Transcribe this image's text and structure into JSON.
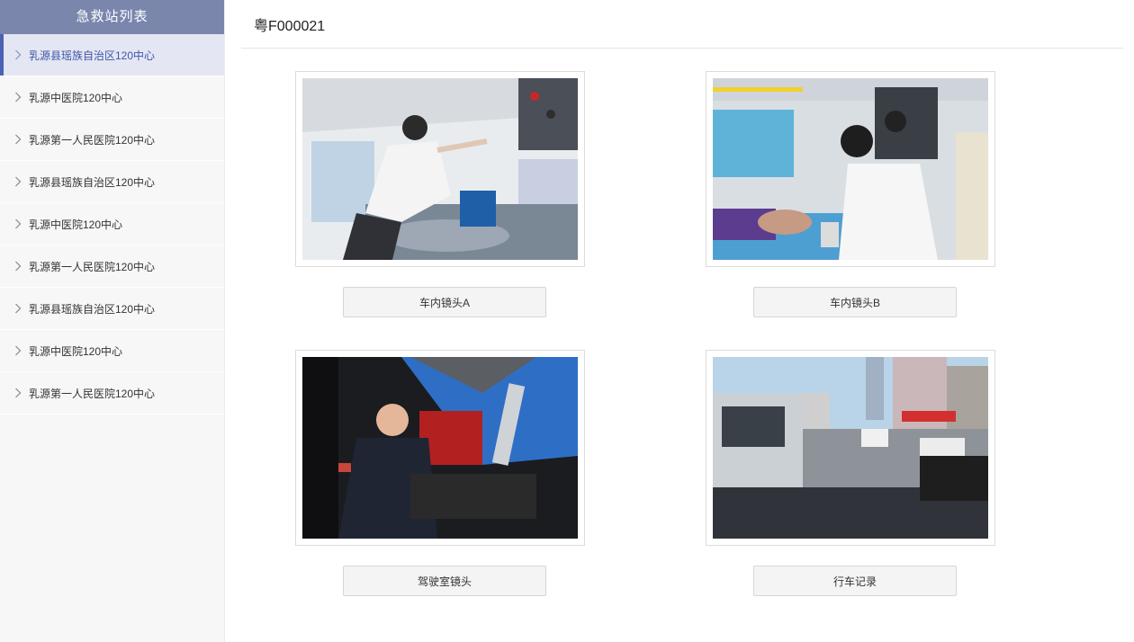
{
  "sidebar": {
    "title": "急救站列表",
    "items": [
      {
        "label": "乳源县瑶族自治区120中心",
        "active": true
      },
      {
        "label": "乳源中医院120中心",
        "active": false
      },
      {
        "label": "乳源第一人民医院120中心",
        "active": false
      },
      {
        "label": "乳源县瑶族自治区120中心",
        "active": false
      },
      {
        "label": "乳源中医院120中心",
        "active": false
      },
      {
        "label": "乳源第一人民医院120中心",
        "active": false
      },
      {
        "label": "乳源县瑶族自治区120中心",
        "active": false
      },
      {
        "label": "乳源中医院120中心",
        "active": false
      },
      {
        "label": "乳源第一人民医院120中心",
        "active": false
      }
    ]
  },
  "header": {
    "plate": "粤F000021"
  },
  "cameras": [
    {
      "label": "车内镜头A",
      "photo": "ambulance-interior-nurse"
    },
    {
      "label": "车内镜头B",
      "photo": "ambulance-interior-patient"
    },
    {
      "label": "驾驶室镜头",
      "photo": "driver-cab-radio"
    },
    {
      "label": "行车记录",
      "photo": "dashcam-street-view"
    }
  ],
  "colors": {
    "sidebar_header": "#7b86ad",
    "active_item_bg": "#e4e6f3",
    "active_item_text": "#3f56a8",
    "active_marker": "#4c62b3"
  }
}
